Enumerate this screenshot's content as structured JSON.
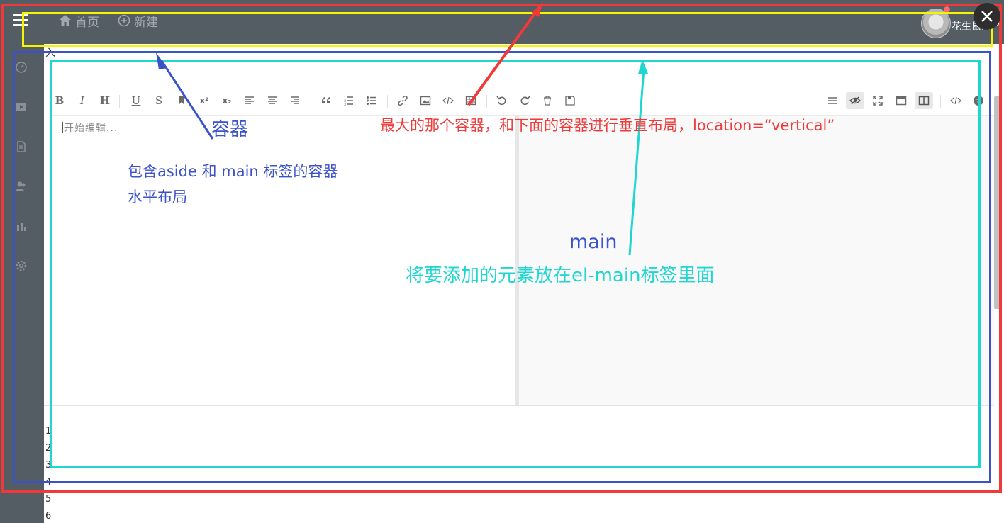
{
  "header": {
    "nav": [
      {
        "label": "首页",
        "icon": "home-icon"
      },
      {
        "label": "新建",
        "icon": "plus-circle-icon"
      }
    ],
    "username": "花生鼠..."
  },
  "aside": {
    "icons": [
      "dashboard-icon",
      "video-icon",
      "document-icon",
      "users-icon",
      "chart-icon",
      "settings-icon"
    ]
  },
  "editor": {
    "placeholder": "开始编辑...",
    "line_numbers": [
      "1",
      "2",
      "3",
      "4",
      "5",
      "6"
    ],
    "stray_char": "入",
    "toolbar": {
      "bold": "B",
      "italic": "I",
      "heading": "H",
      "underline": "U",
      "strike": "S",
      "sup": "x²",
      "sub": "x₂"
    }
  },
  "annotations": {
    "container": "容器",
    "aside_main": [
      "包含aside  和 main 标签的容器",
      "水平布局"
    ],
    "vertical": "最大的那个容器，和下面的容器进行垂直布局，location=“vertical”",
    "main_title": "main",
    "main_desc": "将要添加的元素放在el-main标签里面"
  },
  "colors": {
    "header_bg": "#545c64",
    "red": "#f03a3a",
    "yellow": "#f5f500",
    "blue": "#3c52c8",
    "cyan": "#1fd6d0"
  }
}
